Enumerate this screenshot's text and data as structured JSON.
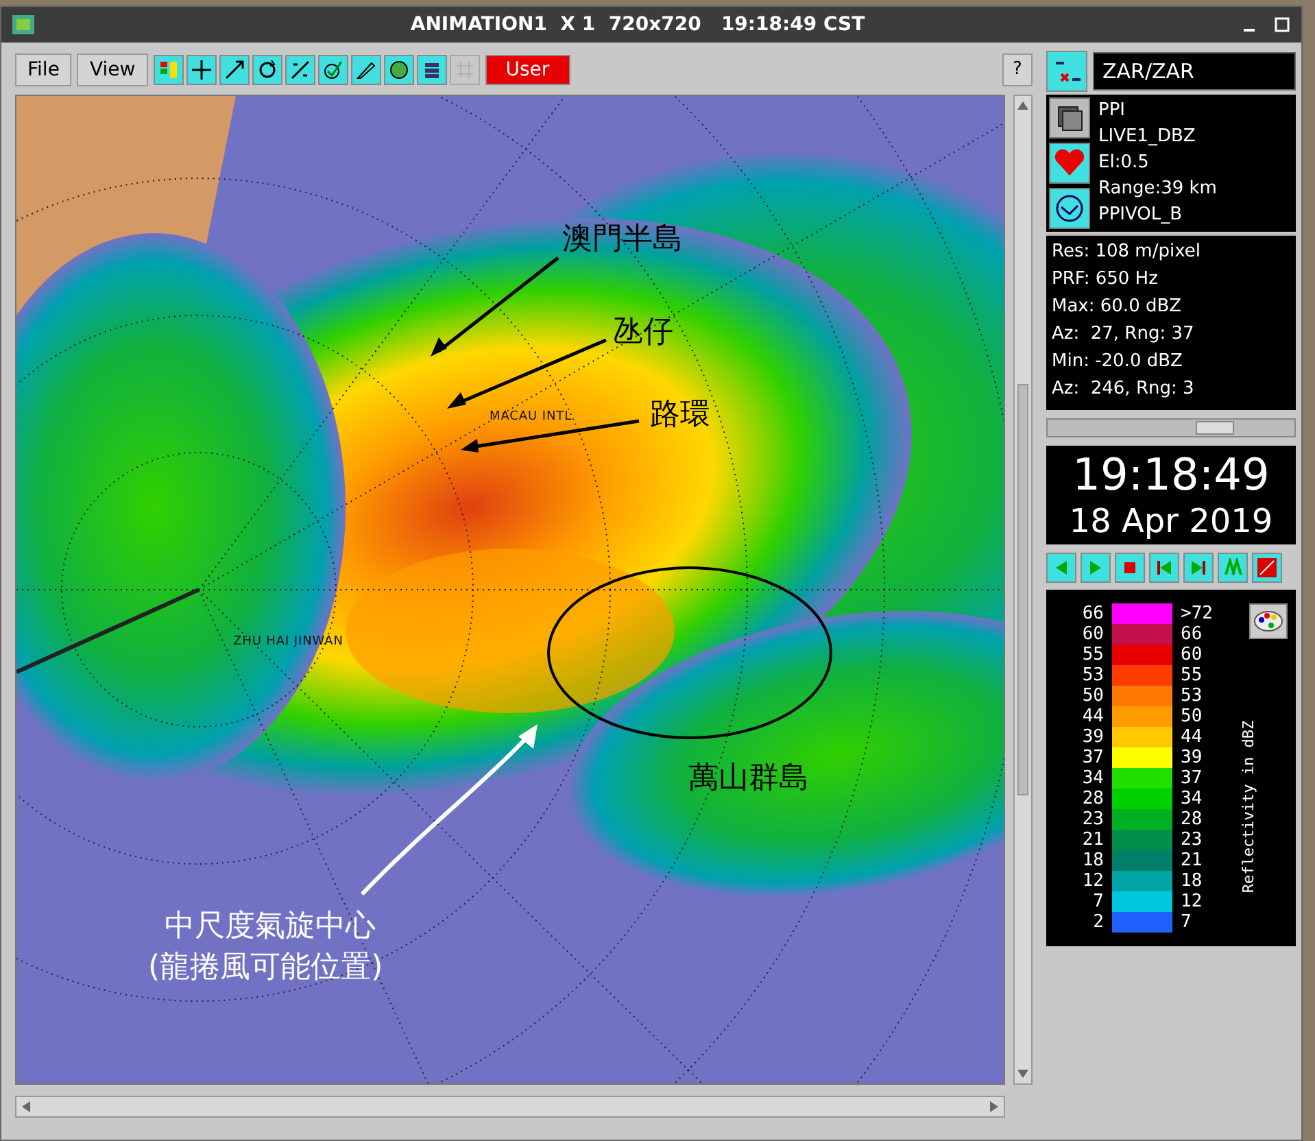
{
  "window": {
    "title": "ANIMATION1  X 1  720x720   19:18:49 CST"
  },
  "menu": [
    {
      "label": "File"
    },
    {
      "label": "View"
    }
  ],
  "toolbar": [
    {
      "kind": "icon",
      "disabled": false
    },
    {
      "kind": "icon",
      "disabled": false
    },
    {
      "kind": "icon",
      "disabled": false
    },
    {
      "kind": "icon",
      "disabled": false
    },
    {
      "kind": "icon",
      "disabled": false
    },
    {
      "kind": "icon",
      "disabled": false
    },
    {
      "kind": "icon",
      "disabled": false
    },
    {
      "kind": "icon",
      "disabled": false
    },
    {
      "kind": "icon",
      "disabled": false
    },
    {
      "kind": "icon",
      "disabled": true
    },
    {
      "kind": "user",
      "label": "User"
    }
  ],
  "help": {
    "label": "?"
  },
  "map": {
    "labels": [
      {
        "text": "MACAU INTL"
      },
      {
        "text": "ZHU HAI JINWAN"
      }
    ],
    "annotations": [
      {
        "text": "澳門半島",
        "color": "#000000"
      },
      {
        "text": "氹仔",
        "color": "#000000"
      },
      {
        "text": "路環",
        "color": "#000000"
      },
      {
        "text": "萬山群島",
        "color": "#000000"
      },
      {
        "text": "中尺度氣旋中心",
        "color": "#ffffff"
      },
      {
        "text": "(龍捲風可能位置)",
        "color": "#ffffff"
      }
    ]
  },
  "site": {
    "value": "ZAR/ZAR"
  },
  "product": [
    "PPI",
    "LIVE1_DBZ",
    "El:0.5",
    "Range:39 km",
    "PPIVOL_B"
  ],
  "stats": [
    "Res: 108 m/pixel",
    "PRF: 650 Hz",
    "Max: 60.0 dBZ",
    "Az:  27, Rng: 37",
    "Min: -20.0 dBZ",
    "Az:  246, Rng: 3"
  ],
  "frame_slider": {
    "level": 0.68
  },
  "time": "19:18:49",
  "date": "18 Apr 2019",
  "legend": {
    "title": "Reflectivity in dBZ",
    "rows": [
      {
        "low": "66",
        "high": ">72",
        "color": "#ff00ff"
      },
      {
        "low": "60",
        "high": "66",
        "color": "#c4104e"
      },
      {
        "low": "55",
        "high": "60",
        "color": "#e80000"
      },
      {
        "low": "53",
        "high": "55",
        "color": "#ff3c00"
      },
      {
        "low": "50",
        "high": "53",
        "color": "#ff7800"
      },
      {
        "low": "44",
        "high": "50",
        "color": "#ff9c00"
      },
      {
        "low": "39",
        "high": "44",
        "color": "#ffc800"
      },
      {
        "low": "37",
        "high": "39",
        "color": "#ffff00"
      },
      {
        "low": "34",
        "high": "37",
        "color": "#20e000"
      },
      {
        "low": "28",
        "high": "34",
        "color": "#00d000"
      },
      {
        "low": "23",
        "high": "28",
        "color": "#00b020"
      },
      {
        "low": "21",
        "high": "23",
        "color": "#00904a"
      },
      {
        "low": "18",
        "high": "21",
        "color": "#00806a"
      },
      {
        "low": "12",
        "high": "18",
        "color": "#00a4a4"
      },
      {
        "low": "7",
        "high": "12",
        "color": "#00c8dc"
      },
      {
        "low": "2",
        "high": "7",
        "color": "#2060ff"
      }
    ]
  }
}
